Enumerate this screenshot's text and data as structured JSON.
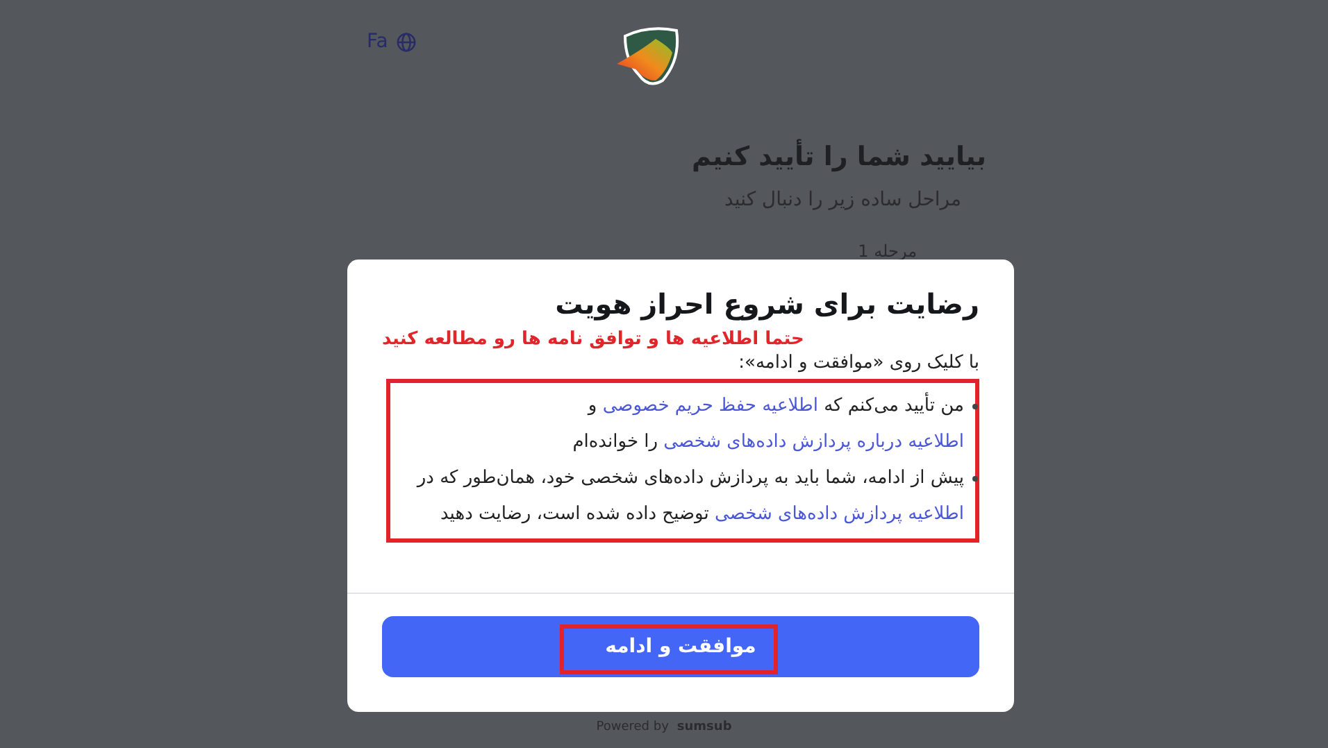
{
  "page": {
    "language": "Fa",
    "heading": "بیایید شما را تأیید کنیم",
    "subtitle": "مراحل ساده زیر را دنبال کنید",
    "step_label": "مرحله 1",
    "powered_by": "Powered by",
    "brand": "sumsub"
  },
  "modal": {
    "title": "رضایت برای شروع احراز هویت",
    "annotation": "حتما اطلاعیه ها و توافق نامه ها رو مطالعه کنید",
    "intro": "با کلیک روی «موافقت و ادامه»:",
    "items": [
      {
        "segments": [
          {
            "kind": "text",
            "text": "من تأیید می‌کنم که "
          },
          {
            "kind": "link",
            "text": "اطلاعیه حفظ حریم خصوصی"
          },
          {
            "kind": "text",
            "text": " و "
          },
          {
            "kind": "link",
            "text": "اطلاعیه درباره پردازش داده‌های شخصی"
          },
          {
            "kind": "text",
            "text": " را خوانده‌ام"
          }
        ]
      },
      {
        "segments": [
          {
            "kind": "text",
            "text": "پیش از ادامه، شما باید به پردازش داده‌های شخصی خود، همان‌طور که در "
          },
          {
            "kind": "link",
            "text": "اطلاعیه پردازش داده‌های شخصی"
          },
          {
            "kind": "text",
            "text": " توضیح داده شده است، رضایت دهید"
          }
        ]
      }
    ],
    "button": "موافقت و ادامه"
  }
}
